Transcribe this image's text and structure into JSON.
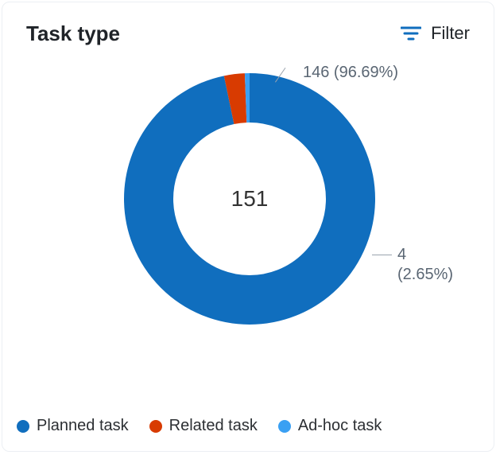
{
  "header": {
    "title": "Task type",
    "filter_label": "Filter"
  },
  "chart_data": {
    "type": "pie",
    "title": "Task type",
    "total": 151,
    "series": [
      {
        "name": "Planned task",
        "value": 146,
        "percent": 96.69,
        "color": "#106ebe"
      },
      {
        "name": "Related task",
        "value": 4,
        "percent": 2.65,
        "color": "#d83b01"
      },
      {
        "name": "Ad-hoc task",
        "value": 1,
        "percent": 0.66,
        "color": "#3aa0f3"
      }
    ],
    "callouts": {
      "top": {
        "text": "146 (96.69%)"
      },
      "right": {
        "line1": "4",
        "line2": "(2.65%)"
      }
    }
  },
  "legend": {
    "items": [
      {
        "label": "Planned task",
        "color": "#106ebe"
      },
      {
        "label": "Related task",
        "color": "#d83b01"
      },
      {
        "label": "Ad-hoc task",
        "color": "#3aa0f3"
      }
    ]
  }
}
